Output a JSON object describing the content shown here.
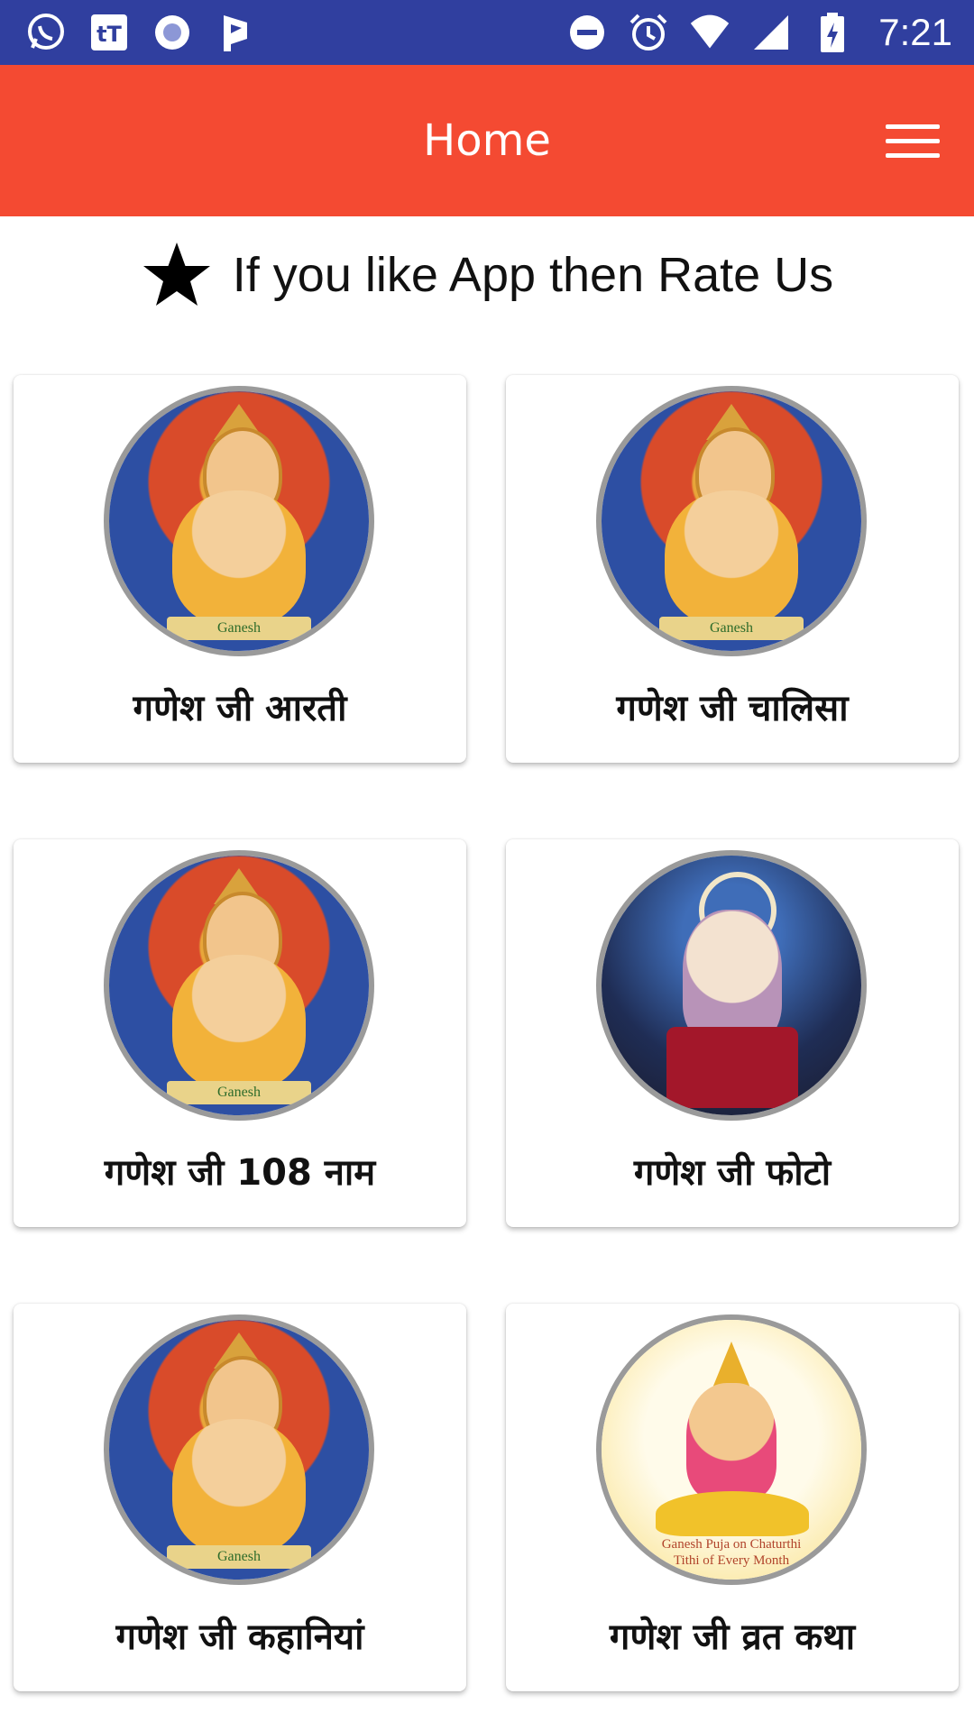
{
  "status_bar": {
    "time": "7:21",
    "left_icons": [
      "whatsapp-icon",
      "tt-app-icon",
      "circle-app-icon",
      "flag-app-icon"
    ],
    "right_icons": [
      "do-not-disturb-icon",
      "alarm-icon",
      "wifi-icon",
      "signal-icon",
      "battery-charging-icon"
    ],
    "color": "#303f9f"
  },
  "app_bar": {
    "title": "Home",
    "color": "#f44a32",
    "menu_icon": "hamburger-menu-icon"
  },
  "rate_banner": {
    "icon": "star-icon",
    "text": "If you like App then Rate Us"
  },
  "cards": [
    {
      "label": "गणेश जी आरती",
      "image": "ganesha-painting"
    },
    {
      "label": "गणेश जी चालिसा",
      "image": "ganesha-painting"
    },
    {
      "label": "गणेश जी 108 नाम",
      "image": "ganesha-painting"
    },
    {
      "label": "गणेश जी फोटो",
      "image": "ganesha-idol-photo"
    },
    {
      "label": "गणेश जी कहानियां",
      "image": "ganesha-painting"
    },
    {
      "label": "गणेश जी व्रत कथा",
      "image": "ganesha-lotus-illustration"
    }
  ],
  "image_captions": {
    "painting_banner": "Ganesh",
    "lotus_caption_line1": "Ganesh Puja on Chaturthi",
    "lotus_caption_line2": "Tithi of Every Month"
  }
}
